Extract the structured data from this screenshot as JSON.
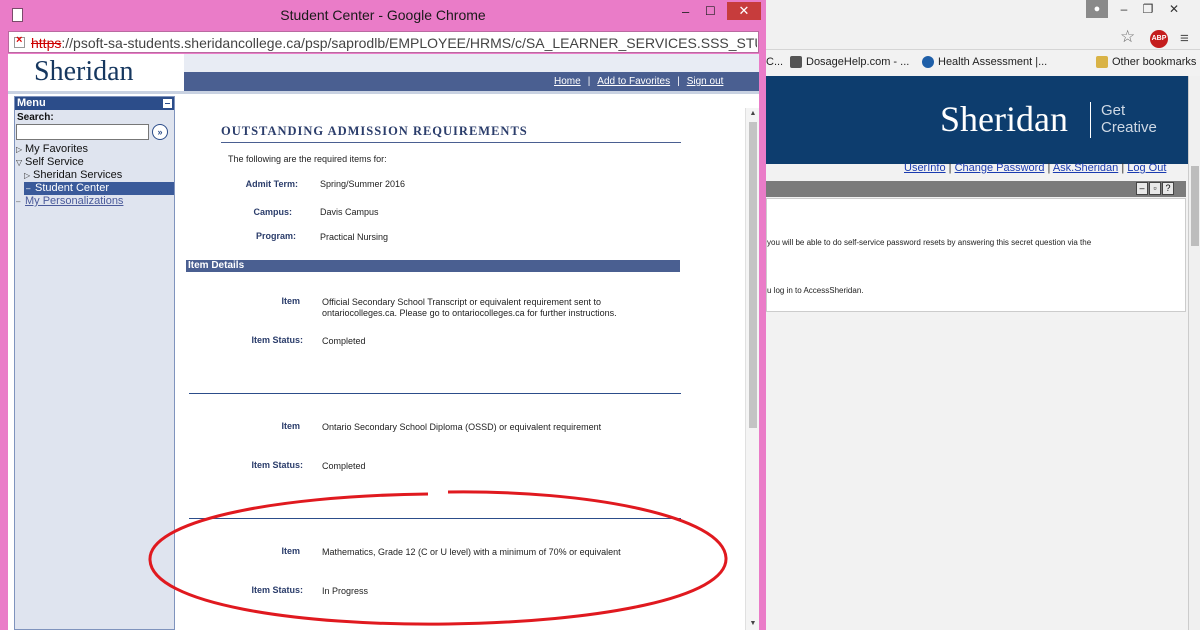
{
  "background_window": {
    "user_icon": "user-icon",
    "controls": [
      "–",
      "❐",
      "✕"
    ],
    "bookmarks": [
      {
        "icon": "page-icon",
        "label": "C..."
      },
      {
        "icon": "page-icon",
        "label": "DosageHelp.com - ..."
      },
      {
        "icon": "globe-icon",
        "label": "Health Assessment |..."
      },
      {
        "icon": "folder-icon",
        "label": "Other bookmarks"
      }
    ],
    "brand": "Sheridan",
    "tagline_1": "Get",
    "tagline_2": "Creative",
    "links": {
      "userinfo": "UserInfo",
      "change_password": "Change Password",
      "ask": "Ask.Sheridan",
      "logout": "Log Out",
      "separator": "|"
    },
    "panel_text_1": "you will be able to do self-service password resets by answering this secret question via the",
    "panel_text_2": "u log in to AccessSheridan.",
    "abp_label": "ABP"
  },
  "popup": {
    "title": "Student Center - Google Chrome",
    "controls": {
      "min": "–",
      "max": "☐",
      "close": "✕"
    },
    "url_scheme": "https",
    "url_rest": "://psoft-sa-students.sheridancollege.ca/psp/saprodlb/EMPLOYEE/HRMS/c/SA_LEARNER_SERVICES.SSS_STUDEN",
    "logo": "Sheridan",
    "nav": {
      "home": "Home",
      "favorites": "Add to Favorites",
      "signout": "Sign out",
      "separator": "|"
    }
  },
  "menu": {
    "title": "Menu",
    "search_label": "Search:",
    "search_value": "",
    "go_symbol": "»",
    "items": [
      {
        "label": "My Favorites",
        "tri": "▷"
      },
      {
        "label": "Self Service",
        "tri": "▽"
      },
      {
        "label": "Sheridan Services",
        "tri": "▷"
      },
      {
        "label": "Student Center",
        "tri": "–"
      },
      {
        "label": "My Personalizations",
        "tri": "–"
      }
    ]
  },
  "main": {
    "title": "OUTSTANDING ADMISSION REQUIREMENTS",
    "intro": "The following are the required items for:",
    "admit_term_label": "Admit Term:",
    "admit_term": "Spring/Summer 2016",
    "campus_label": "Campus:",
    "campus": "Davis Campus",
    "program_label": "Program:",
    "program": "Practical Nursing",
    "section": "Item Details",
    "item_label": "Item",
    "status_label": "Item Status:",
    "items": [
      {
        "item": "Official Secondary School Transcript or equivalent requirement sent to ontariocolleges.ca. Please go to ontariocolleges.ca for further instructions.",
        "status": "Completed"
      },
      {
        "item": "Ontario Secondary School Diploma (OSSD) or equivalent requirement",
        "status": "Completed"
      },
      {
        "item": "Mathematics, Grade 12 (C or U level) with a minimum of 70% or equivalent",
        "status": "In Progress"
      }
    ]
  },
  "scroll": {
    "up": "▲",
    "down": "▼"
  },
  "colors": {
    "popup_frame": "#ea7cc8",
    "header_blue": "#4a5f91",
    "bg_header": "#0d3d6e",
    "annotation_red": "#e0191f"
  }
}
